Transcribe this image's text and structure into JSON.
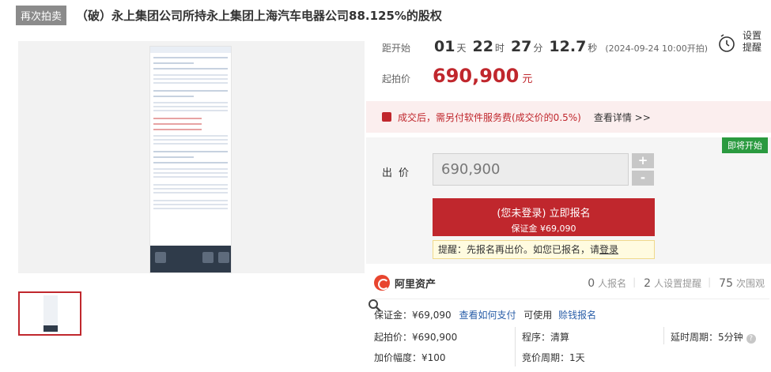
{
  "header": {
    "tag": "再次拍卖",
    "title": "（破）永上集团公司所持永上集团上海汽车电器公司88.125%的股权"
  },
  "countdown": {
    "label": "距开始",
    "days": "01",
    "days_unit": "天",
    "hours": "22",
    "hours_unit": "时",
    "minutes": "27",
    "minutes_unit": "分",
    "seconds": "12.7",
    "seconds_unit": "秒",
    "start_time": "(2024-09-24 10:00开拍)"
  },
  "remind": {
    "label": "设置提醒"
  },
  "start_price": {
    "label": "起拍价",
    "value": "690,900",
    "unit": "元"
  },
  "fee_notice": {
    "text": "成交后，需另付软件服务费(成交价的0.5%)",
    "link": "查看详情 >>"
  },
  "bid": {
    "badge": "即将开始",
    "label": "出价",
    "value": "690,900",
    "plus": "+",
    "minus": "-",
    "signup_line1": "(您未登录) 立即报名",
    "signup_line2": "保证金 ¥69,090",
    "tip_text": "提醒：先报名再出价。如您已报名，请",
    "tip_link": "登录"
  },
  "brand": {
    "name": "阿里资产"
  },
  "stats": {
    "signups": "0",
    "signups_label": "人报名",
    "reminders": "2",
    "reminders_label": "人设置提醒",
    "views": "75",
    "views_label": "次围观"
  },
  "details": {
    "deposit": "保证金：¥69,090",
    "how_to_pay": "查看如何支付",
    "available": "可使用",
    "credit_signup": "赊钱报名",
    "start_price": "起拍价：¥690,900",
    "procedure": "程序：清算",
    "delay": "延时周期：5分钟",
    "increment": "加价幅度：¥100",
    "cycle": "竞价周期：1天"
  },
  "colors": {
    "accent": "#c0272d",
    "link": "#2a5ea8",
    "badge": "#2a9a3f"
  },
  "icons": {
    "zoom": "magnifier-icon",
    "remind": "clock-icon",
    "fee": "bag-icon",
    "help": "question-icon"
  }
}
